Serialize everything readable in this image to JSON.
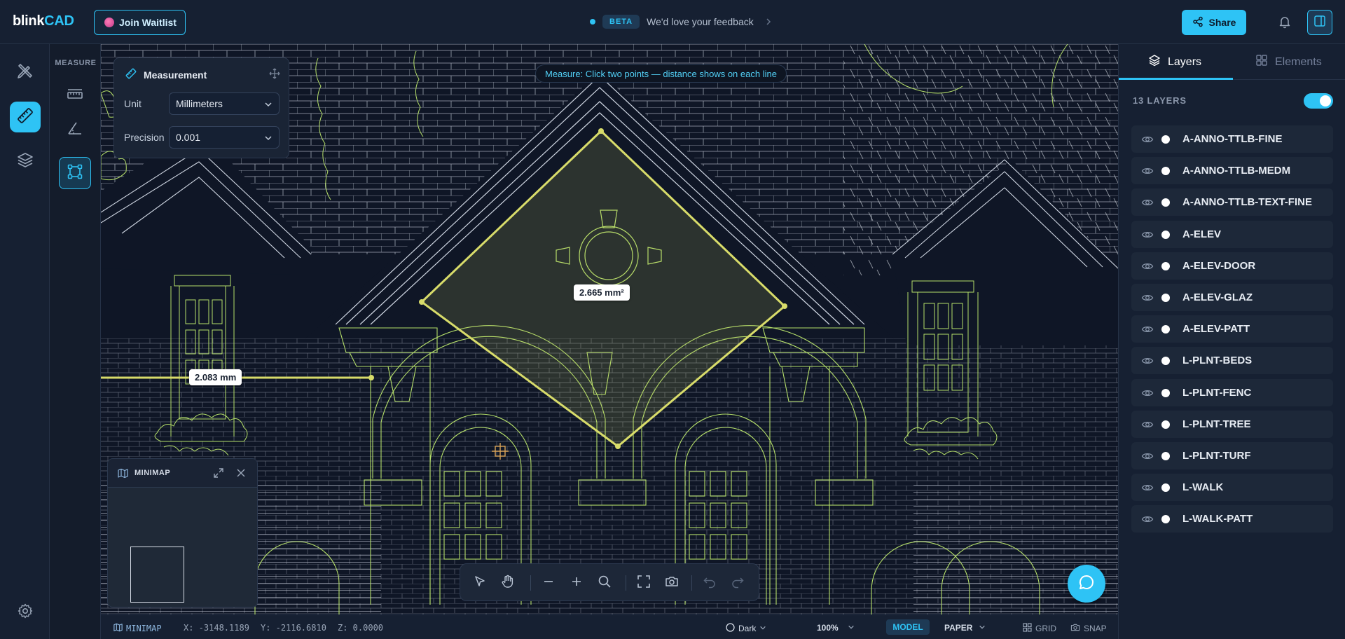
{
  "app": {
    "logo_part1": "blink",
    "logo_part2": "CAD",
    "join_waitlist": "Join Waitlist",
    "beta_badge": "BETA",
    "beta_text": "We'd love your feedback",
    "share": "Share"
  },
  "colors": {
    "accent": "#2ec3f5",
    "drawing_line": "#b6e06a",
    "measure_line": "#d8dc6a",
    "canvas_bg": "#0f1626"
  },
  "toolcol": {
    "title": "MEASURE"
  },
  "measurement": {
    "title": "Measurement",
    "unit_label": "Unit",
    "unit_value": "Millimeters",
    "precision_label": "Precision",
    "precision_value": "0.001"
  },
  "canvas": {
    "hint": "Measure: Click two points — distance shows on each line",
    "area_label": "2.665 mm²",
    "distance_label": "2.083 mm"
  },
  "minimap": {
    "title": "MINIMAP"
  },
  "statusbar": {
    "minimap": "MINIMAP",
    "x": "X: -3148.1189",
    "y": "Y: -2116.6810",
    "z": "Z: 0.0000",
    "theme": "Dark",
    "zoom": "100%",
    "model": "MODEL",
    "paper": "PAPER",
    "grid": "GRID",
    "snap": "SNAP"
  },
  "rpanel": {
    "tab_layers": "Layers",
    "tab_elements": "Elements",
    "layer_count": "13 LAYERS",
    "layers": [
      "A-ANNO-TTLB-FINE",
      "A-ANNO-TTLB-MEDM",
      "A-ANNO-TTLB-TEXT-FINE",
      "A-ELEV",
      "A-ELEV-DOOR",
      "A-ELEV-GLAZ",
      "A-ELEV-PATT",
      "L-PLNT-BEDS",
      "L-PLNT-FENC",
      "L-PLNT-TREE",
      "L-PLNT-TURF",
      "L-WALK",
      "L-WALK-PATT"
    ]
  }
}
